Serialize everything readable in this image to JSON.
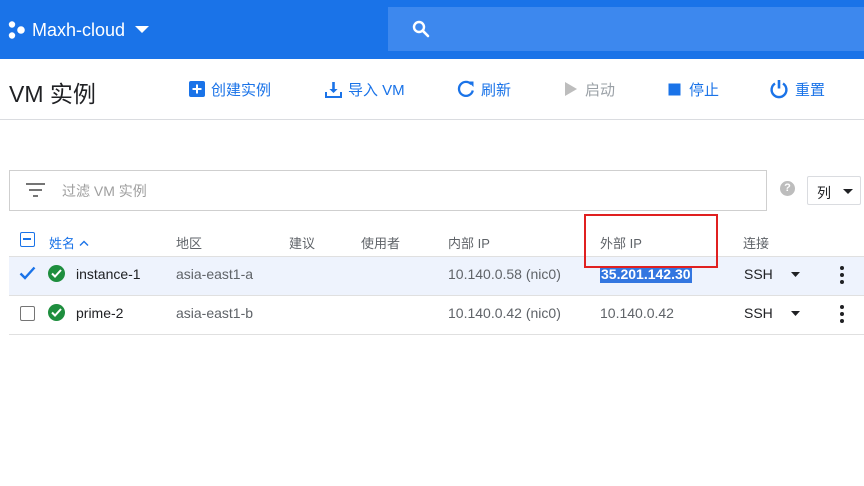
{
  "project": {
    "name": "Maxh-cloud"
  },
  "search": {
    "placeholder": "",
    "value": ""
  },
  "toolbar": {
    "title": "VM 实例",
    "create_label": "创建实例",
    "import_label": "导入 VM",
    "refresh_label": "刷新",
    "start_label": "启动",
    "stop_label": "停止",
    "reset_label": "重置"
  },
  "filter": {
    "placeholder": "过滤 VM 实例",
    "value": ""
  },
  "help": {
    "label": "?"
  },
  "columns_button": {
    "label": "列"
  },
  "table": {
    "headers": {
      "name": "姓名",
      "zone": "地区",
      "recommendation": "建议",
      "in_use_by": "使用者",
      "internal_ip": "内部 IP",
      "external_ip": "外部 IP",
      "connect": "连接"
    },
    "rows": [
      {
        "name": "instance-1",
        "zone": "asia-east1-a",
        "recommendation": "",
        "in_use_by": "",
        "internal_ip": "10.140.0.58 (nic0)",
        "external_ip": "35.201.142.30",
        "connect": "SSH",
        "checked": true,
        "status": "running"
      },
      {
        "name": "prime-2",
        "zone": "asia-east1-b",
        "recommendation": "",
        "in_use_by": "",
        "internal_ip": "10.140.0.42 (nic0)",
        "external_ip": "10.140.0.42",
        "connect": "SSH",
        "checked": false,
        "status": "running"
      }
    ]
  },
  "colors": {
    "topbar": "#1a73e8",
    "accent": "#1a73e8",
    "status_ok": "#1e8e3e",
    "selected_row": "#eef3fd",
    "text_selection": "#3376e0",
    "annotation_box": "#e02020"
  },
  "icons": {
    "project": "project-dots-icon",
    "search": "search-icon",
    "create": "add-box-icon",
    "import": "download-icon",
    "refresh": "refresh-icon",
    "start": "play-icon",
    "stop": "stop-icon",
    "reset": "power-icon",
    "filter": "filter-icon",
    "sort": "sort-ascending-icon",
    "status": "check-circle-icon",
    "more": "more-vert-icon"
  }
}
